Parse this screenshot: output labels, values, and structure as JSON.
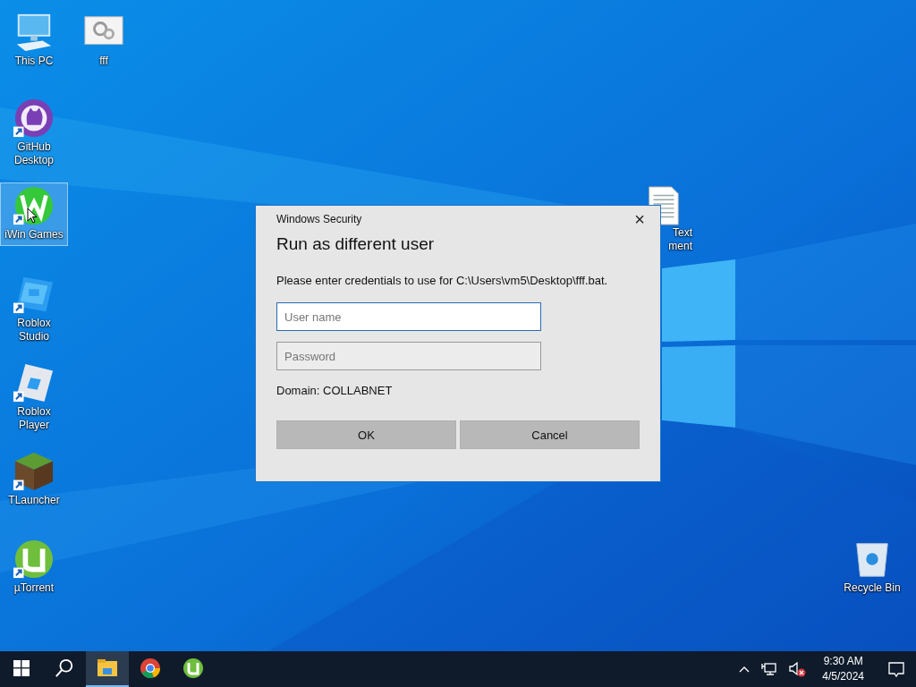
{
  "desktop_icons": [
    {
      "kind": "pc",
      "label": "This PC",
      "shortcut": false,
      "selected": false
    },
    {
      "kind": "gear-file",
      "label": "fff",
      "shortcut": false,
      "selected": false
    },
    {
      "kind": "github",
      "label": "GitHub Desktop",
      "shortcut": true,
      "selected": false
    },
    {
      "kind": "iwin",
      "label": "iWin Games",
      "shortcut": true,
      "selected": true
    },
    {
      "kind": "roblox-studio",
      "label": "Roblox Studio",
      "shortcut": true,
      "selected": false
    },
    {
      "kind": "roblox-player",
      "label": "Roblox Player",
      "shortcut": true,
      "selected": false
    },
    {
      "kind": "tlauncher",
      "label": "TLauncher",
      "shortcut": true,
      "selected": false
    },
    {
      "kind": "utorrent",
      "label": "µTorrent",
      "shortcut": true,
      "selected": false
    },
    {
      "kind": "text-document",
      "label_lines": [
        "Text",
        "ment"
      ],
      "shortcut": false,
      "selected": false
    },
    {
      "kind": "recycle-bin",
      "label": "Recycle Bin",
      "shortcut": false,
      "selected": false
    }
  ],
  "dialog": {
    "caption": "Windows Security",
    "close": "×",
    "title": "Run as different user",
    "message": "Please enter credentials to use for C:\\Users\\vm5\\Desktop\\fff.bat.",
    "fields": [
      {
        "placeholder": "User name",
        "focused": true
      },
      {
        "placeholder": "Password",
        "focused": false
      }
    ],
    "domain": "Domain: COLLABNET",
    "buttons": [
      "OK",
      "Cancel"
    ]
  },
  "taskbar": {
    "apps": [
      {
        "kind": "file-explorer",
        "active": true
      },
      {
        "kind": "chrome",
        "active": false
      },
      {
        "kind": "utorrent",
        "active": false
      }
    ],
    "tray": {
      "volume_muted": true,
      "time": "9:30 AM",
      "date": "4/5/2024"
    }
  }
}
